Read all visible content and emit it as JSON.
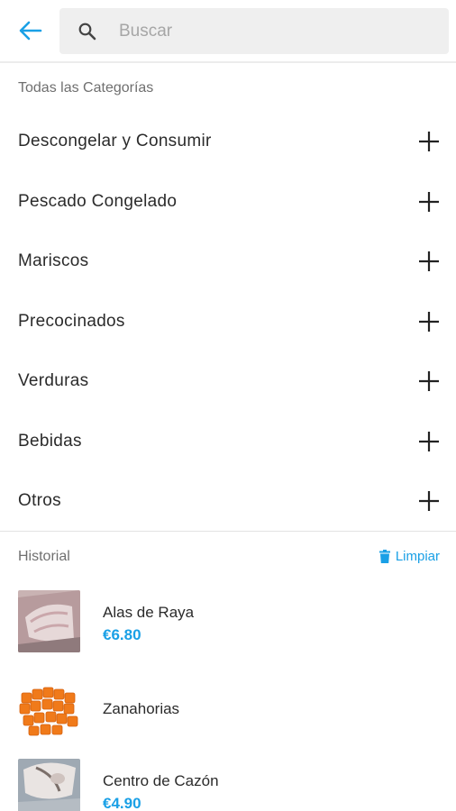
{
  "header": {
    "back_icon": "arrow-left-icon",
    "search_icon": "search-icon",
    "search_placeholder": "Buscar",
    "search_value": "",
    "accent_color": "#1aa0e6"
  },
  "categories": {
    "title": "Todas las Categorías",
    "items": [
      {
        "label": "Descongelar y Consumir",
        "icon": "plus-icon"
      },
      {
        "label": "Pescado Congelado",
        "icon": "plus-icon"
      },
      {
        "label": "Mariscos",
        "icon": "plus-icon"
      },
      {
        "label": "Precocinados",
        "icon": "plus-icon"
      },
      {
        "label": "Verduras",
        "icon": "plus-icon"
      },
      {
        "label": "Bebidas",
        "icon": "plus-icon"
      },
      {
        "label": "Otros",
        "icon": "plus-icon"
      }
    ]
  },
  "history": {
    "title": "Historial",
    "clear_label": "Limpiar",
    "clear_icon": "trash-icon",
    "items": [
      {
        "name": "Alas de Raya",
        "price": "€6.80"
      },
      {
        "name": "Zanahorias",
        "price": ""
      },
      {
        "name": "Centro de Cazón",
        "price": "€4.90"
      }
    ]
  }
}
